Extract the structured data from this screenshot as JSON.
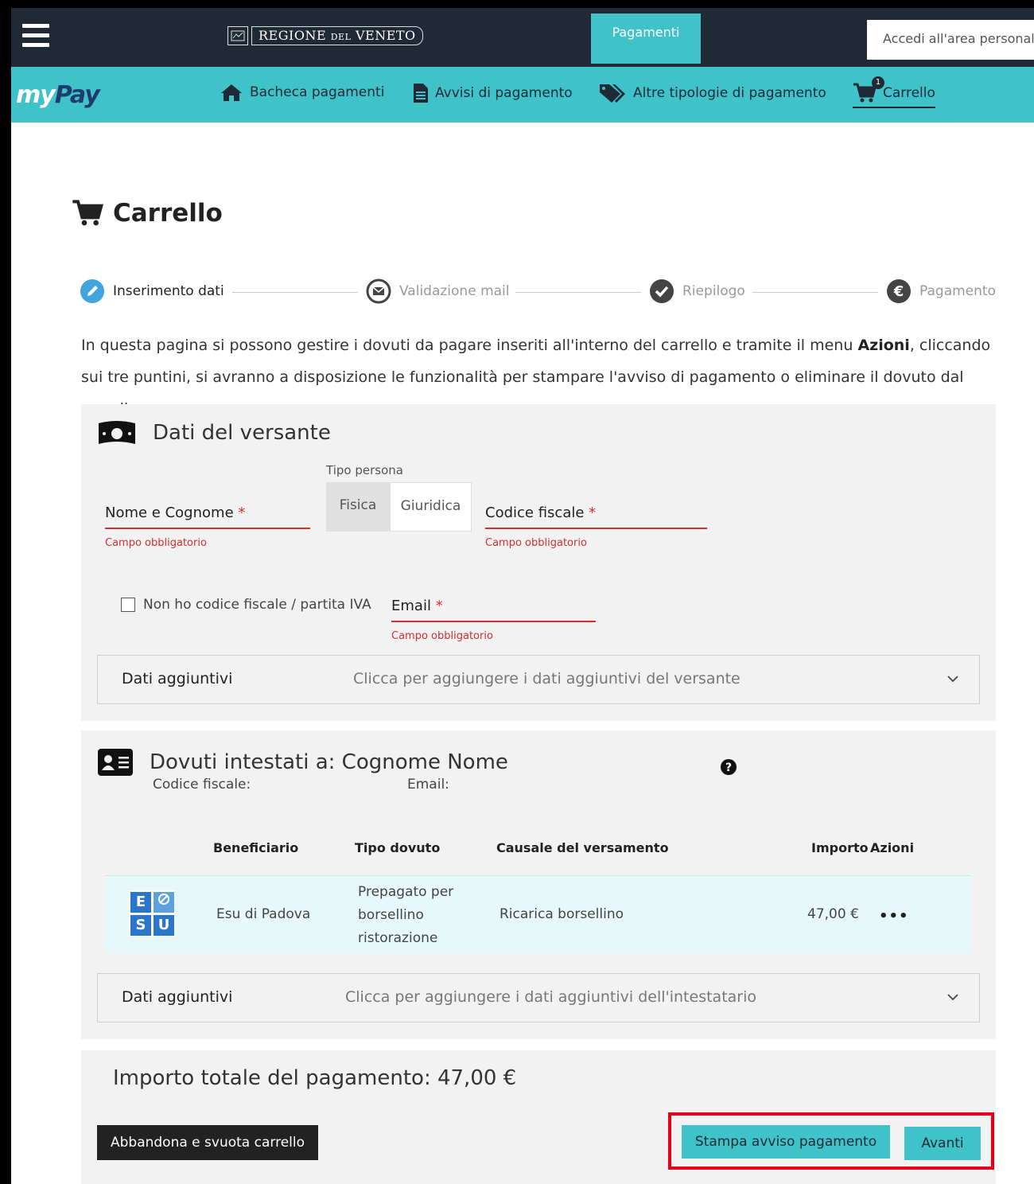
{
  "header": {
    "region_name_part1": "REGIONE ",
    "region_name_part2": "DEL",
    "region_name_part3": " VENETO",
    "active_tab": "Pagamenti",
    "login_button": "Accedi all'area personale"
  },
  "nav": {
    "logo_my": "my",
    "logo_pay": "Pay",
    "items": [
      {
        "label": "Bacheca pagamenti",
        "icon": "home-icon"
      },
      {
        "label": "Avvisi di pagamento",
        "icon": "document-icon"
      },
      {
        "label": "Altre tipologie di pagamento",
        "icon": "tags-icon"
      },
      {
        "label": "Carrello",
        "icon": "cart-icon"
      }
    ],
    "cart_count": "1"
  },
  "page": {
    "title": "Carrello"
  },
  "stepper": {
    "steps": [
      {
        "label": "Inserimento dati",
        "icon": "pencil-icon",
        "active": true
      },
      {
        "label": "Validazione mail",
        "icon": "envelope-icon",
        "active": false
      },
      {
        "label": "Riepilogo",
        "icon": "check-icon",
        "active": false
      },
      {
        "label": "Pagamento",
        "icon": "euro-icon",
        "active": false
      }
    ]
  },
  "intro": {
    "text_before": "In questa pagina si possono gestire i dovuti da pagare inseriti all'interno del carrello e tramite il menu ",
    "bold": "Azioni",
    "text_after": ", cliccando sui tre puntini, si avranno a disposizione le funzionalità per stampare l'avviso di pagamento o eliminare il dovuto dal carrello."
  },
  "versante": {
    "title": "Dati del versante",
    "name_label": "Nome e Cognome",
    "required_mark": "*",
    "error_text": "Campo obbligatorio",
    "tipo_persona_label": "Tipo persona",
    "tipo_persona_options": [
      "Fisica",
      "Giuridica"
    ],
    "codice_fiscale_label": "Codice fiscale",
    "no_cf_checkbox_label": "Non ho codice fiscale / partita IVA",
    "email_label": "Email",
    "accordion_title": "Dati aggiuntivi",
    "accordion_desc": "Clicca per aggiungere i dati aggiuntivi del versante"
  },
  "dovuti": {
    "title": "Dovuti intestati a: Cognome Nome",
    "cf_label": "Codice fiscale:",
    "email_label": "Email:",
    "columns": [
      "Beneficiario",
      "Tipo dovuto",
      "Causale del versamento",
      "Importo",
      "Azioni"
    ],
    "rows": [
      {
        "logo_letters": [
          "E",
          "",
          "S",
          "U"
        ],
        "beneficiario": "Esu di Padova",
        "tipo_dovuto": "Prepagato per borsellino ristorazione",
        "causale": "Ricarica borsellino",
        "importo": "47,00 €",
        "azioni": "•••"
      }
    ],
    "accordion_title": "Dati aggiuntivi",
    "accordion_desc": "Clicca per aggiungere i dati aggiuntivi dell'intestatario"
  },
  "totale": {
    "text": "Importo totale del pagamento: 47,00 €",
    "abandon_button": "Abbandona e svuota carrello",
    "print_button": "Stampa avviso pagamento",
    "next_button": "Avanti"
  },
  "colors": {
    "teal": "#3fc2c9",
    "dark": "#1f2a36",
    "error": "#d32f2f",
    "highlight": "#e3001b"
  }
}
